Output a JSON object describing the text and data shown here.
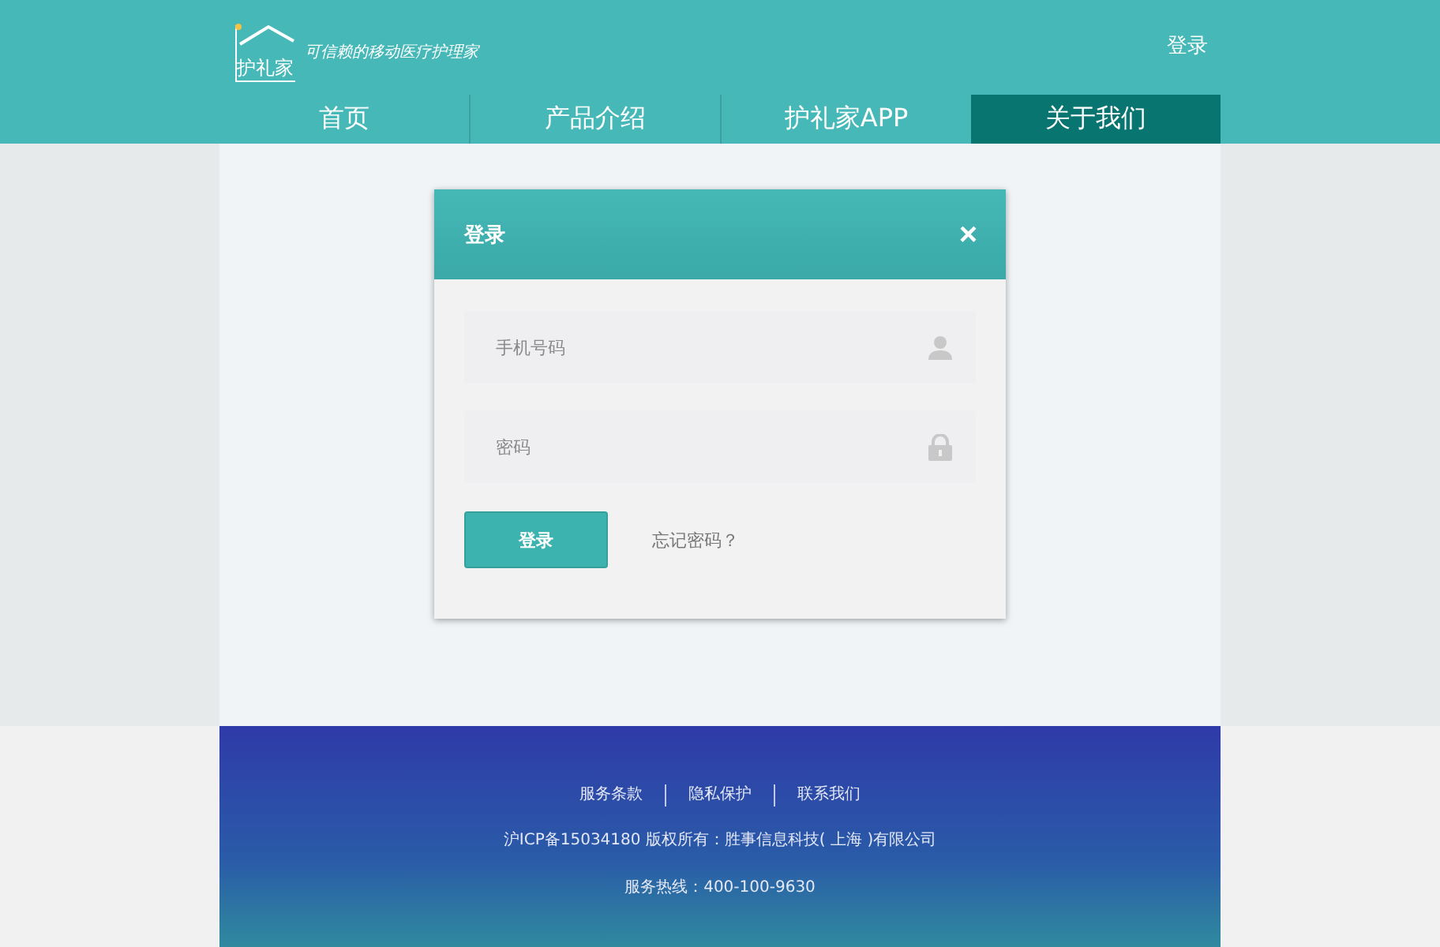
{
  "header": {
    "logo_text": "护礼家",
    "tagline": "可信赖的移动医疗护理家",
    "login_link": "登录"
  },
  "nav": [
    {
      "label": "首页",
      "selected": false
    },
    {
      "label": "产品介绍",
      "selected": false
    },
    {
      "label": "护礼家APP",
      "selected": false
    },
    {
      "label": "关于我们",
      "selected": true
    }
  ],
  "dialog": {
    "title": "登录",
    "close": "×",
    "fields": [
      {
        "placeholder": "手机号码",
        "kind": "user"
      },
      {
        "placeholder": "密码",
        "kind": "lock"
      }
    ],
    "submit": "登录",
    "forgot": "忘记密码？"
  },
  "footer": {
    "links": [
      "服务条款",
      "隐私保护",
      "联系我们"
    ],
    "copyright": "沪ICP备15034180 版权所有：胜事信息科技( 上海 )有限公司",
    "hotline": "服务热线：400-100-9630"
  }
}
